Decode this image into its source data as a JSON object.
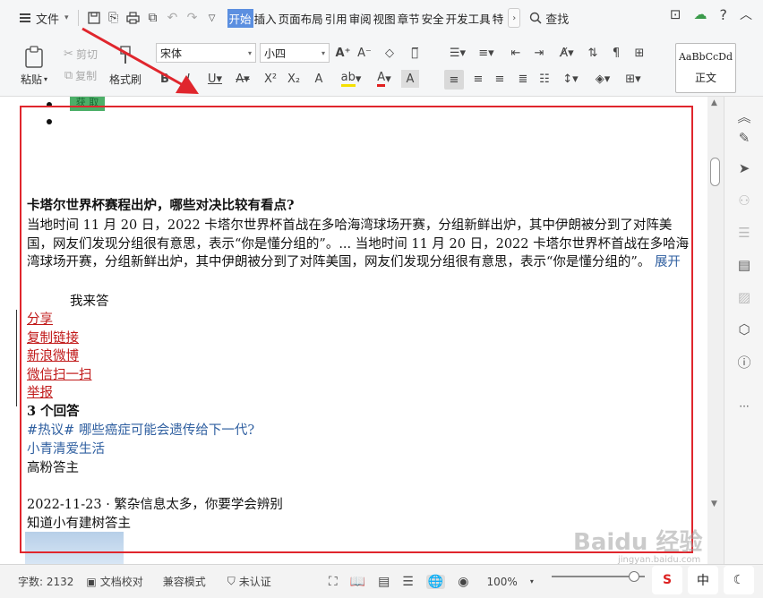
{
  "menubar": {
    "file_label": "文件",
    "tabs": [
      "开始",
      "插入",
      "页面布局",
      "引用",
      "审阅",
      "视图",
      "章节",
      "安全",
      "开发工具",
      "特"
    ],
    "active_tab": "开始",
    "search_label": "查找"
  },
  "ribbon": {
    "paste_label": "粘贴",
    "cut_label": "剪切",
    "copy_label": "复制",
    "format_painter_label": "格式刷",
    "font_name": "宋体",
    "font_size": "小四",
    "style_sample": "AaBbCcDd",
    "style_name": "正文"
  },
  "document": {
    "tag_text": "获 取",
    "title": "卡塔尔世界杯赛程出炉，哪些对决比较有看点?",
    "paragraph": "当地时间 11 月 20 日，2022 卡塔尔世界杯首战在多哈海湾球场开赛，分组新鲜出炉，其中伊朗被分到了对阵美国，网友们发现分组很有意思，表示“你是懂分组的”。...  当地时间 11 月 20 日，2022 卡塔尔世界杯首战在多哈海湾球场开赛，分组新鲜出炉，其中伊朗被分到了对阵美国，网友们发现分组很有意思，表示“你是懂分组的”。",
    "expand_label": "展开",
    "answer_label": "我来答",
    "share_links": [
      "分享",
      "复制链接",
      "新浪微博",
      "微信扫一扫",
      "举报"
    ],
    "answers_count": "3 个回答",
    "hot_topic": "#热议# 哪些癌症可能会遗传给下一代?",
    "user1": "小青清爱生活",
    "user1_title": "高粉答主",
    "date_line": "2022-11-23  ·  繁杂信息太多，你要学会辨别",
    "user2_line": "知道小有建树答主"
  },
  "statusbar": {
    "word_count": "字数: 2132",
    "proofread": "文档校对",
    "compat_mode": "兼容模式",
    "uncertified": "未认证",
    "zoom": "100%"
  },
  "ime": {
    "lang": "中"
  },
  "watermark": {
    "brand": "Baidu 经验",
    "url": "jingyan.baidu.com"
  },
  "colors": {
    "annotation_red": "#e0262d",
    "active_tab_blue": "#5b8fe0",
    "link_blue": "#2f5fa0",
    "link_red": "#c01818"
  }
}
